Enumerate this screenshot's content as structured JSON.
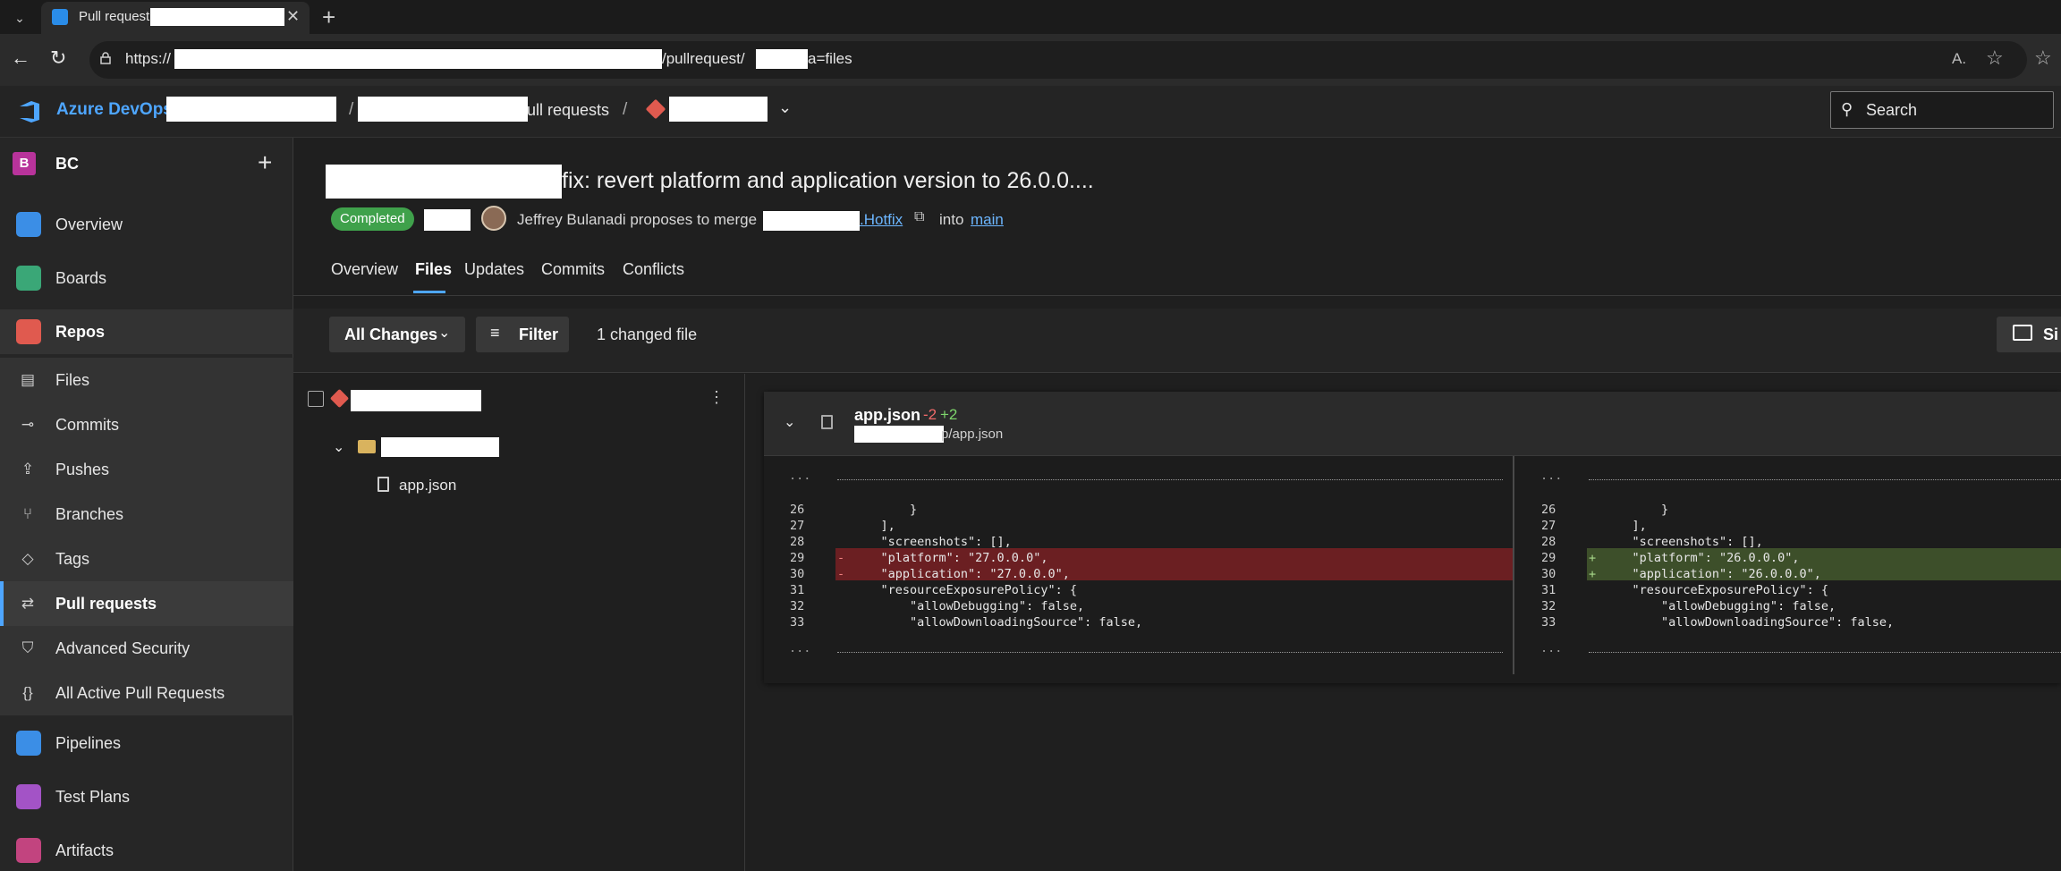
{
  "browser": {
    "tab_title": "Pull request",
    "close_glyph": "✕",
    "new_tab_glyph": "+",
    "url_prefix": "https://",
    "url_middle": "/pullrequest/",
    "url_suffix": "a=files"
  },
  "header": {
    "brand": "Azure DevOps",
    "breadcrumb_sep": "/",
    "breadcrumb_prs": "ull requests",
    "search_placeholder": "Search"
  },
  "sidebar": {
    "project_initial": "B",
    "project_name": "BC",
    "items": [
      {
        "label": "Overview",
        "icon": "overview-icon",
        "color": "#3b8ee6"
      },
      {
        "label": "Boards",
        "icon": "boards-icon",
        "color": "#3aa777"
      },
      {
        "label": "Repos",
        "icon": "repos-icon",
        "color": "#e05a4f"
      },
      {
        "label": "Files",
        "icon": "files-icon"
      },
      {
        "label": "Commits",
        "icon": "commits-icon"
      },
      {
        "label": "Pushes",
        "icon": "pushes-icon"
      },
      {
        "label": "Branches",
        "icon": "branches-icon"
      },
      {
        "label": "Tags",
        "icon": "tags-icon"
      },
      {
        "label": "Pull requests",
        "icon": "pull-requests-icon"
      },
      {
        "label": "Advanced Security",
        "icon": "shield-icon"
      },
      {
        "label": "All Active Pull Requests",
        "icon": "braces-icon"
      },
      {
        "label": "Pipelines",
        "icon": "pipelines-icon",
        "color": "#3b8ee6"
      },
      {
        "label": "Test Plans",
        "icon": "test-plans-icon",
        "color": "#a353c6"
      },
      {
        "label": "Artifacts",
        "icon": "artifacts-icon",
        "color": "#c2447f"
      }
    ]
  },
  "pr": {
    "title": "fix: revert platform and application version to 26.0.0....",
    "status": "Completed",
    "author_text": "Jeffrey Bulanadi proposes to merge",
    "source_branch": ".Hotfix",
    "into_text": "into",
    "target_branch": "main",
    "tabs": [
      "Overview",
      "Files",
      "Updates",
      "Commits",
      "Conflicts"
    ]
  },
  "toolbar": {
    "all_changes": "All Changes",
    "filter": "Filter",
    "changed_count": "1 changed file",
    "side_by_side": "Si"
  },
  "tree": {
    "file_name": "app.json"
  },
  "diff": {
    "file_name": "app.json",
    "deletions": "-2",
    "additions": "+2",
    "path_suffix": "p/app.json",
    "ellipsis": "...",
    "left": {
      "lines": [
        {
          "num": "26",
          "code": "        }"
        },
        {
          "num": "27",
          "code": "    ],"
        },
        {
          "num": "28",
          "code": "    \"screenshots\": [],"
        },
        {
          "num": "29",
          "code": "    \"platform\": \"27.0.0.0\",",
          "type": "del"
        },
        {
          "num": "30",
          "code": "    \"application\": \"27.0.0.0\",",
          "type": "del"
        },
        {
          "num": "31",
          "code": "    \"resourceExposurePolicy\": {"
        },
        {
          "num": "32",
          "code": "        \"allowDebugging\": false,"
        },
        {
          "num": "33",
          "code": "        \"allowDownloadingSource\": false,"
        }
      ]
    },
    "right": {
      "lines": [
        {
          "num": "26",
          "code": "        }"
        },
        {
          "num": "27",
          "code": "    ],"
        },
        {
          "num": "28",
          "code": "    \"screenshots\": [],"
        },
        {
          "num": "29",
          "code": "    \"platform\": \"26.0.0.0\",",
          "type": "add"
        },
        {
          "num": "30",
          "code": "    \"application\": \"26.0.0.0\",",
          "type": "add"
        },
        {
          "num": "31",
          "code": "    \"resourceExposurePolicy\": {"
        },
        {
          "num": "32",
          "code": "        \"allowDebugging\": false,"
        },
        {
          "num": "33",
          "code": "        \"allowDownloadingSource\": false,"
        }
      ]
    },
    "del_marker": "-",
    "add_marker": "+"
  }
}
